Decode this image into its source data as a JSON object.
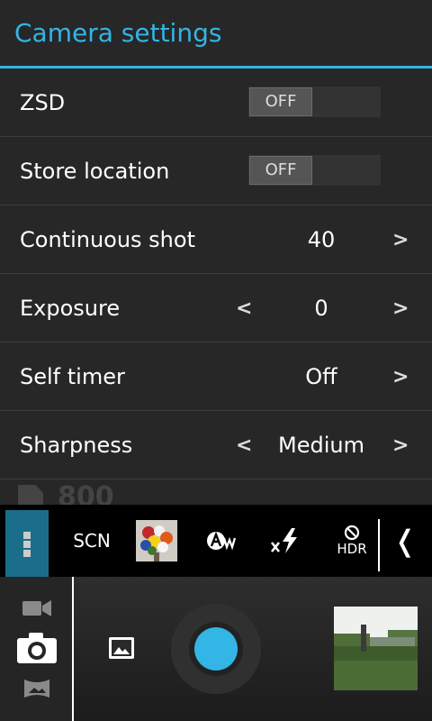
{
  "settings": {
    "title": "Camera settings",
    "items": [
      {
        "label": "ZSD",
        "type": "toggle",
        "value": "OFF"
      },
      {
        "label": "Store location",
        "type": "toggle",
        "value": "OFF"
      },
      {
        "label": "Continuous shot",
        "type": "next",
        "value": "40"
      },
      {
        "label": "Exposure",
        "type": "stepper",
        "value": "0"
      },
      {
        "label": "Self timer",
        "type": "next",
        "value": "Off"
      },
      {
        "label": "Sharpness",
        "type": "stepper",
        "value": "Medium"
      }
    ],
    "arrow_left": "<",
    "arrow_right": ">"
  },
  "overlay": {
    "remaining_shots": "800"
  },
  "toolbar": {
    "scene_label": "SCN",
    "hdr_label": "HDR",
    "collapse_glyph": "❬",
    "icons": [
      "more-options-icon",
      "color-effect-icon",
      "white-balance-auto-icon",
      "flash-off-icon",
      "hdr-off-icon",
      "collapse-icon"
    ]
  },
  "controls": {
    "modes": [
      "video-mode-icon",
      "photo-mode-icon",
      "panorama-mode-icon"
    ],
    "colors": {
      "accent": "#33b5e5",
      "settings_bg": "#272727"
    }
  }
}
